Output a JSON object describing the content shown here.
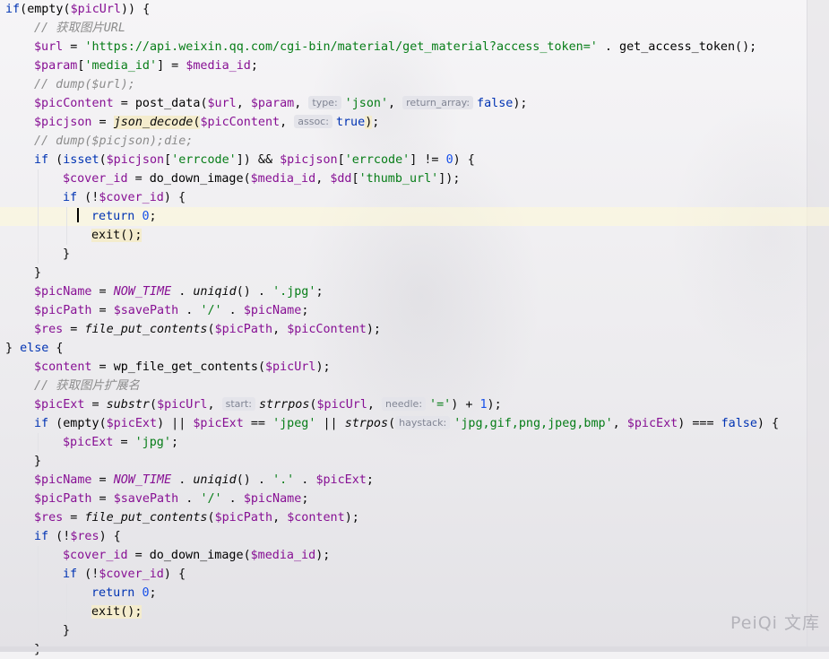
{
  "editor": {
    "lines": [
      {
        "indent": 0,
        "tokens": [
          [
            "kw",
            "if"
          ],
          [
            "",
            "("
          ],
          [
            "fn",
            "empty"
          ],
          [
            "",
            "("
          ],
          [
            "var",
            "$picUrl"
          ],
          [
            "",
            ")) {"
          ]
        ]
      },
      {
        "indent": 1,
        "tokens": [
          [
            "cmt",
            "// 获取图片URL"
          ]
        ]
      },
      {
        "indent": 1,
        "tokens": [
          [
            "var",
            "$url"
          ],
          [
            "",
            " = "
          ],
          [
            "str",
            "'https://api.weixin.qq.com/cgi-bin/material/get_material?access_token='"
          ],
          [
            "",
            " . "
          ],
          [
            "fn",
            "get_access_token"
          ],
          [
            "",
            "();"
          ]
        ]
      },
      {
        "indent": 1,
        "tokens": [
          [
            "var",
            "$param"
          ],
          [
            "",
            "["
          ],
          [
            "str",
            "'media_id'"
          ],
          [
            "",
            "] = "
          ],
          [
            "var",
            "$media_id"
          ],
          [
            "",
            ";"
          ]
        ]
      },
      {
        "indent": 1,
        "tokens": [
          [
            "cmt",
            "// dump($url);"
          ]
        ]
      },
      {
        "indent": 1,
        "tokens": [
          [
            "var",
            "$picContent"
          ],
          [
            "",
            " = "
          ],
          [
            "fn",
            "post_data"
          ],
          [
            "",
            "("
          ],
          [
            "var",
            "$url"
          ],
          [
            "",
            ", "
          ],
          [
            "var",
            "$param"
          ],
          [
            "",
            ", "
          ],
          [
            "hint",
            "type:"
          ],
          [
            "str",
            "'json'"
          ],
          [
            "",
            ", "
          ],
          [
            "hint",
            "return_array:"
          ],
          [
            "kw",
            "false"
          ],
          [
            "",
            ");"
          ]
        ]
      },
      {
        "indent": 1,
        "tokens": [
          [
            "var",
            "$picjson"
          ],
          [
            "",
            " = "
          ],
          [
            "hlfn",
            "json_decode"
          ],
          [
            "hlp",
            "("
          ],
          [
            "var",
            "$picContent"
          ],
          [
            "",
            ", "
          ],
          [
            "hint",
            "assoc:"
          ],
          [
            "kw",
            "true"
          ],
          [
            "hlp",
            ")"
          ],
          [
            "",
            ";"
          ]
        ]
      },
      {
        "indent": 1,
        "tokens": [
          [
            "cmt",
            "// dump($picjson);die;"
          ]
        ]
      },
      {
        "indent": 1,
        "tokens": [
          [
            "kw",
            "if"
          ],
          [
            "",
            " ("
          ],
          [
            "kw",
            "isset"
          ],
          [
            "",
            "("
          ],
          [
            "var",
            "$picjson"
          ],
          [
            "",
            "["
          ],
          [
            "str",
            "'errcode'"
          ],
          [
            "",
            "]) && "
          ],
          [
            "var",
            "$picjson"
          ],
          [
            "",
            "["
          ],
          [
            "str",
            "'errcode'"
          ],
          [
            "",
            "] != "
          ],
          [
            "num",
            "0"
          ],
          [
            "",
            ") {"
          ]
        ]
      },
      {
        "indent": 2,
        "tokens": [
          [
            "var",
            "$cover_id"
          ],
          [
            "",
            " = "
          ],
          [
            "fn",
            "do_down_image"
          ],
          [
            "",
            "("
          ],
          [
            "var",
            "$media_id"
          ],
          [
            "",
            ", "
          ],
          [
            "var",
            "$dd"
          ],
          [
            "",
            "["
          ],
          [
            "str",
            "'thumb_url'"
          ],
          [
            "",
            "]);"
          ]
        ]
      },
      {
        "indent": 2,
        "tokens": [
          [
            "kw",
            "if"
          ],
          [
            "",
            " (!"
          ],
          [
            "var",
            "$cover_id"
          ],
          [
            "",
            ") {"
          ]
        ]
      },
      {
        "indent": 3,
        "caret": true,
        "hl": true,
        "tokens": [
          [
            "kw",
            "return "
          ],
          [
            "num",
            "0"
          ],
          [
            "",
            ";"
          ]
        ]
      },
      {
        "indent": 3,
        "tokens": [
          [
            "hlkw",
            "exit();"
          ]
        ]
      },
      {
        "indent": 2,
        "tokens": [
          [
            "",
            "}"
          ]
        ]
      },
      {
        "indent": 1,
        "tokens": [
          [
            "",
            "}"
          ]
        ]
      },
      {
        "indent": 1,
        "tokens": [
          [
            "var",
            "$picName"
          ],
          [
            "",
            " = "
          ],
          [
            "const",
            "NOW_TIME"
          ],
          [
            "",
            " . "
          ],
          [
            "fni",
            "uniqid"
          ],
          [
            "",
            "() . "
          ],
          [
            "str",
            "'.jpg'"
          ],
          [
            "",
            ";"
          ]
        ]
      },
      {
        "indent": 1,
        "tokens": [
          [
            "var",
            "$picPath"
          ],
          [
            "",
            " = "
          ],
          [
            "var",
            "$savePath"
          ],
          [
            "",
            " . "
          ],
          [
            "str",
            "'/'"
          ],
          [
            "",
            " . "
          ],
          [
            "var",
            "$picName"
          ],
          [
            "",
            ";"
          ]
        ]
      },
      {
        "indent": 1,
        "tokens": [
          [
            "var",
            "$res"
          ],
          [
            "",
            " = "
          ],
          [
            "fni",
            "file_put_contents"
          ],
          [
            "",
            "("
          ],
          [
            "var",
            "$picPath"
          ],
          [
            "",
            ", "
          ],
          [
            "var",
            "$picContent"
          ],
          [
            "",
            ");"
          ]
        ]
      },
      {
        "indent": 0,
        "tokens": [
          [
            "",
            "} "
          ],
          [
            "kw",
            "else"
          ],
          [
            "",
            " {"
          ]
        ]
      },
      {
        "indent": 1,
        "tokens": [
          [
            "var",
            "$content"
          ],
          [
            "",
            " = "
          ],
          [
            "fn",
            "wp_file_get_contents"
          ],
          [
            "",
            "("
          ],
          [
            "var",
            "$picUrl"
          ],
          [
            "",
            ");"
          ]
        ]
      },
      {
        "indent": 1,
        "tokens": [
          [
            "cmt",
            "// 获取图片扩展名"
          ]
        ]
      },
      {
        "indent": 1,
        "tokens": [
          [
            "var",
            "$picExt"
          ],
          [
            "",
            " = "
          ],
          [
            "fni",
            "substr"
          ],
          [
            "",
            "("
          ],
          [
            "var",
            "$picUrl"
          ],
          [
            "",
            ", "
          ],
          [
            "hint",
            "start:"
          ],
          [
            "fni",
            "strrpos"
          ],
          [
            "",
            "("
          ],
          [
            "var",
            "$picUrl"
          ],
          [
            "",
            ", "
          ],
          [
            "hint",
            "needle:"
          ],
          [
            "str",
            "'='"
          ],
          [
            "",
            ") + "
          ],
          [
            "num",
            "1"
          ],
          [
            "",
            ");"
          ]
        ]
      },
      {
        "indent": 1,
        "tokens": [
          [
            "kw",
            "if"
          ],
          [
            "",
            " ("
          ],
          [
            "fn",
            "empty"
          ],
          [
            "",
            "("
          ],
          [
            "var",
            "$picExt"
          ],
          [
            "",
            ") || "
          ],
          [
            "var",
            "$picExt"
          ],
          [
            "",
            " == "
          ],
          [
            "str",
            "'jpeg'"
          ],
          [
            "",
            " || "
          ],
          [
            "fni",
            "strpos"
          ],
          [
            "",
            "("
          ],
          [
            "hint",
            "haystack:"
          ],
          [
            "str",
            "'jpg,gif,png,jpeg,bmp'"
          ],
          [
            "",
            ", "
          ],
          [
            "var",
            "$picExt"
          ],
          [
            "",
            ") === "
          ],
          [
            "kw",
            "false"
          ],
          [
            "",
            ") {"
          ]
        ]
      },
      {
        "indent": 2,
        "tokens": [
          [
            "var",
            "$picExt"
          ],
          [
            "",
            " = "
          ],
          [
            "str",
            "'jpg'"
          ],
          [
            "",
            ";"
          ]
        ]
      },
      {
        "indent": 1,
        "tokens": [
          [
            "",
            "}"
          ]
        ]
      },
      {
        "indent": 1,
        "tokens": [
          [
            "var",
            "$picName"
          ],
          [
            "",
            " = "
          ],
          [
            "const",
            "NOW_TIME"
          ],
          [
            "",
            " . "
          ],
          [
            "fni",
            "uniqid"
          ],
          [
            "",
            "() . "
          ],
          [
            "str",
            "'.'"
          ],
          [
            "",
            " . "
          ],
          [
            "var",
            "$picExt"
          ],
          [
            "",
            ";"
          ]
        ]
      },
      {
        "indent": 1,
        "tokens": [
          [
            "var",
            "$picPath"
          ],
          [
            "",
            " = "
          ],
          [
            "var",
            "$savePath"
          ],
          [
            "",
            " . "
          ],
          [
            "str",
            "'/'"
          ],
          [
            "",
            " . "
          ],
          [
            "var",
            "$picName"
          ],
          [
            "",
            ";"
          ]
        ]
      },
      {
        "indent": 1,
        "tokens": [
          [
            "var",
            "$res"
          ],
          [
            "",
            " = "
          ],
          [
            "fni",
            "file_put_contents"
          ],
          [
            "",
            "("
          ],
          [
            "var",
            "$picPath"
          ],
          [
            "",
            ", "
          ],
          [
            "var",
            "$content"
          ],
          [
            "",
            ");"
          ]
        ]
      },
      {
        "indent": 1,
        "tokens": [
          [
            "kw",
            "if"
          ],
          [
            "",
            " (!"
          ],
          [
            "var",
            "$res"
          ],
          [
            "",
            ") {"
          ]
        ]
      },
      {
        "indent": 2,
        "tokens": [
          [
            "var",
            "$cover_id"
          ],
          [
            "",
            " = "
          ],
          [
            "fn",
            "do_down_image"
          ],
          [
            "",
            "("
          ],
          [
            "var",
            "$media_id"
          ],
          [
            "",
            ");"
          ]
        ]
      },
      {
        "indent": 2,
        "tokens": [
          [
            "kw",
            "if"
          ],
          [
            "",
            " (!"
          ],
          [
            "var",
            "$cover_id"
          ],
          [
            "",
            ") {"
          ]
        ]
      },
      {
        "indent": 3,
        "tokens": [
          [
            "kw",
            "return "
          ],
          [
            "num",
            "0"
          ],
          [
            "",
            ";"
          ]
        ]
      },
      {
        "indent": 3,
        "tokens": [
          [
            "hlkw",
            "exit();"
          ]
        ]
      },
      {
        "indent": 2,
        "tokens": [
          [
            "",
            "}"
          ]
        ]
      },
      {
        "indent": 1,
        "tokens": [
          [
            "",
            "}"
          ]
        ]
      }
    ]
  },
  "watermark": "PeiQi 文库",
  "colors": {
    "keyword": "#0033b3",
    "variable": "#871094",
    "string": "#067d17",
    "number": "#1750eb",
    "comment": "#8c8c8c",
    "hint_bg": "#e4e4ea",
    "highlight_bg": "#f4eccd"
  }
}
